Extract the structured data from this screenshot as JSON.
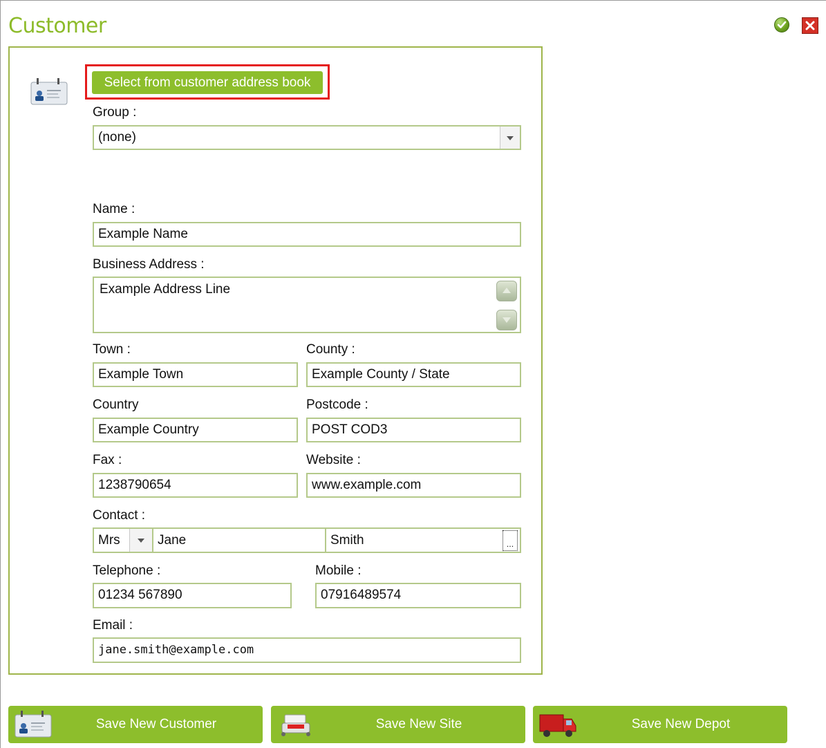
{
  "window": {
    "title": "Customer"
  },
  "actions": {
    "select_book_label": "Select from customer address book"
  },
  "labels": {
    "group": "Group :",
    "name": "Name :",
    "business_address": "Business Address :",
    "town": "Town :",
    "county": "County :",
    "country": "Country",
    "postcode": "Postcode :",
    "fax": "Fax :",
    "website": "Website :",
    "contact": "Contact :",
    "telephone": "Telephone :",
    "mobile": "Mobile :",
    "email": "Email :"
  },
  "values": {
    "group": "(none)",
    "name": "Example Name",
    "business_address": "Example Address Line",
    "town": "Example Town",
    "county": "Example County / State",
    "country": "Example Country",
    "postcode": "POST COD3",
    "fax": "1238790654",
    "website": "www.example.com",
    "contact_title": "Mrs",
    "contact_first": "Jane",
    "contact_last": "Smith",
    "contact_more": "...",
    "telephone": "01234 567890",
    "mobile": "07916489574",
    "email": "jane.smith@example.com"
  },
  "bottom_buttons": [
    {
      "label": "Save New Customer",
      "icon": "address-card-icon"
    },
    {
      "label": "Save New Site",
      "icon": "site-icon"
    },
    {
      "label": "Save New Depot",
      "icon": "truck-icon"
    }
  ],
  "colors": {
    "accent": "#8dbe2c",
    "title": "#8dbb2a",
    "field_border": "#b4c98a",
    "highlight": "#e51b1b",
    "close": "#d43127"
  }
}
